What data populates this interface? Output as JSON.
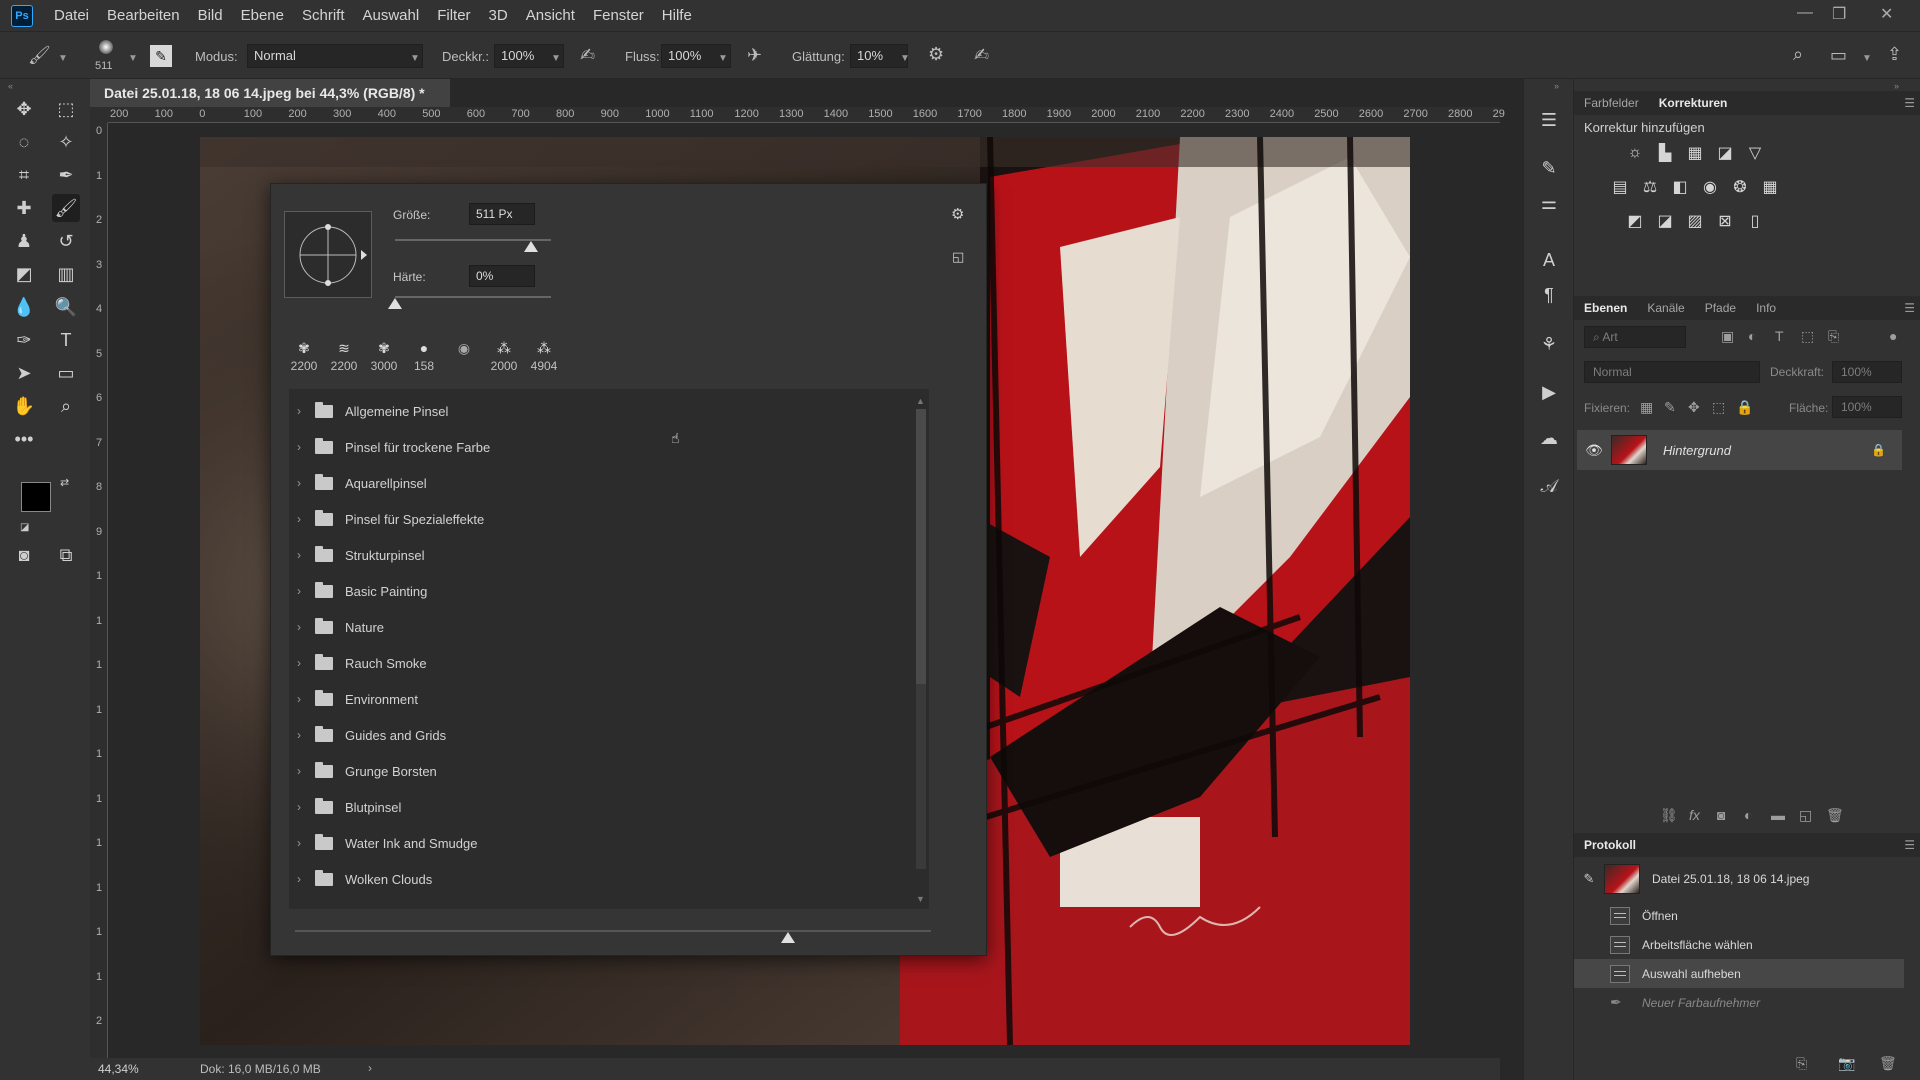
{
  "menu": {
    "items": [
      "Datei",
      "Bearbeiten",
      "Bild",
      "Ebene",
      "Schrift",
      "Auswahl",
      "Filter",
      "3D",
      "Ansicht",
      "Fenster",
      "Hilfe"
    ]
  },
  "options": {
    "brush_size": "511",
    "mode_label": "Modus:",
    "mode_value": "Normal",
    "opacity_label": "Deckkr.:",
    "opacity_value": "100%",
    "flow_label": "Fluss:",
    "flow_value": "100%",
    "smoothing_label": "Glättung:",
    "smoothing_value": "10%"
  },
  "document": {
    "tab_title": "Datei 25.01.18, 18 06 14.jpeg bei 44,3% (RGB/8) *",
    "zoom": "44,34%",
    "doc_info": "Dok: 16,0 MB/16,0 MB"
  },
  "rulers": {
    "h_ticks": [
      "200",
      "100",
      "0",
      "100",
      "200",
      "300",
      "400",
      "500",
      "600",
      "700",
      "800",
      "900",
      "1000",
      "1100",
      "1200",
      "1300",
      "1400",
      "1500",
      "1600",
      "1700",
      "1800",
      "1900",
      "2000",
      "2100",
      "2200",
      "2300",
      "2400",
      "2500",
      "2600",
      "2700",
      "2800",
      "29"
    ],
    "v_ticks": [
      "0",
      "1",
      "2",
      "3",
      "4",
      "5",
      "6",
      "7",
      "8",
      "9",
      "1",
      "1",
      "1",
      "1",
      "1",
      "1",
      "1",
      "1",
      "1",
      "1",
      "2"
    ]
  },
  "brush_panel": {
    "size_label": "Größe:",
    "size_value": "511 Px",
    "size_fraction": 0.87,
    "hardness_label": "Härte:",
    "hardness_value": "0%",
    "hardness_fraction": 0.0,
    "presets": [
      {
        "icon": "✾",
        "size": "2200"
      },
      {
        "icon": "≋",
        "size": "2200"
      },
      {
        "icon": "✾",
        "size": "3000"
      },
      {
        "icon": "●",
        "size": "158"
      },
      {
        "icon": "◉",
        "size": ""
      },
      {
        "icon": "⁂",
        "size": "2000"
      },
      {
        "icon": "⁂",
        "size": "4904"
      }
    ],
    "folders": [
      "Allgemeine Pinsel",
      "Pinsel für trockene Farbe",
      "Aquarellpinsel",
      "Pinsel für Spezialeffekte",
      "Strukturpinsel",
      "Basic Painting",
      "Nature",
      "Rauch Smoke",
      "Environment",
      "Guides and Grids",
      "Grunge Borsten",
      "Blutpinsel",
      "Water Ink and Smudge",
      "Wolken Clouds"
    ]
  },
  "panels": {
    "color_tab": "Farbfelder",
    "adjust_tab": "Korrekturen",
    "adjust_hint": "Korrektur hinzufügen",
    "layers_tabs": [
      "Ebenen",
      "Kanäle",
      "Pfade",
      "Info"
    ],
    "layer_filter_placeholder": "Art",
    "blend_mode": "Normal",
    "opacity_label": "Deckkraft:",
    "opacity_value": "100%",
    "lock_label": "Fixieren:",
    "fill_label": "Fläche:",
    "fill_value": "100%",
    "layer_name": "Hintergrund",
    "history_tab": "Protokoll",
    "history_snapshot": "Datei 25.01.18, 18 06 14.jpeg",
    "history_items": [
      "Öffnen",
      "Arbeitsfläche wählen",
      "Auswahl aufheben",
      "Neuer Farbaufnehmer"
    ]
  },
  "colors": {
    "accent_blue": "#31a8ff",
    "panel": "#323232",
    "red_art": "#c8141c"
  }
}
